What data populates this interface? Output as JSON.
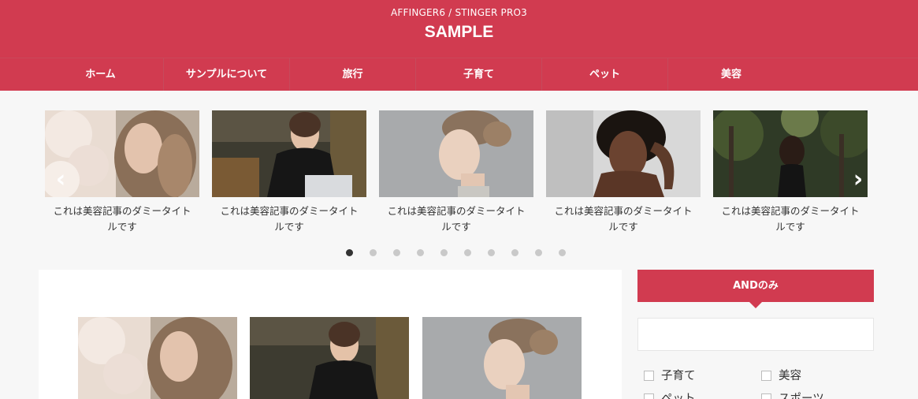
{
  "header": {
    "tagline": "AFFINGER6 / STINGER PRO3",
    "site_title": "SAMPLE",
    "bg_color": "#d13b50"
  },
  "nav": {
    "items": [
      "ホーム",
      "サンプルについて",
      "旅行",
      "子育て",
      "ペット",
      "美容"
    ]
  },
  "slider": {
    "slides": [
      {
        "caption": "これは美容記事のダミータイトルです"
      },
      {
        "caption": "これは美容記事のダミータイトルです"
      },
      {
        "caption": "これは美容記事のダミータイトルです"
      },
      {
        "caption": "これは美容記事のダミータイトルです"
      },
      {
        "caption": "これは美容記事のダミータイトルです"
      }
    ],
    "prev_icon": "chevron-left-icon",
    "next_icon": "chevron-right-icon",
    "dot_count": 10,
    "active_dot": 1
  },
  "sidebar": {
    "widget_title": "ANDのみ",
    "checkboxes": [
      "子育て",
      "美容",
      "ペット",
      "スポーツ"
    ]
  }
}
